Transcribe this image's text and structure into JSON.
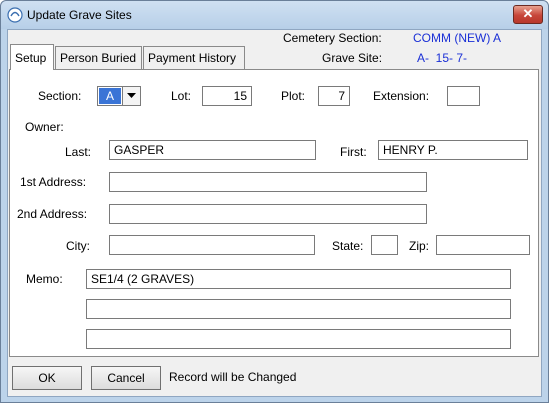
{
  "window": {
    "title": "Update Grave Sites",
    "close_glyph": "✕"
  },
  "header": {
    "cemetery_section_label": "Cemetery Section:",
    "cemetery_section_value": "COMM (NEW) A",
    "grave_site_label": "Grave Site:",
    "grave_site_value": "A-  15- 7-"
  },
  "tabs": [
    {
      "label": "Setup",
      "active": true
    },
    {
      "label": "Person Buried",
      "active": false
    },
    {
      "label": "Payment History",
      "active": false
    }
  ],
  "form": {
    "section_label": "Section:",
    "section_value": "A",
    "lot_label": "Lot:",
    "lot_value": "15",
    "plot_label": "Plot:",
    "plot_value": "7",
    "extension_label": "Extension:",
    "extension_value": "",
    "owner_label": "Owner:",
    "last_label": "Last:",
    "last_value": "GASPER",
    "first_label": "First:",
    "first_value": "HENRY P.",
    "address1_label": "1st Address:",
    "address1_value": "",
    "address2_label": "2nd Address:",
    "address2_value": "",
    "city_label": "City:",
    "city_value": "",
    "state_label": "State:",
    "state_value": "",
    "zip_label": "Zip:",
    "zip_value": "",
    "memo_label": "Memo:",
    "memo_lines": [
      "SE1/4 (2 GRAVES)",
      "",
      ""
    ]
  },
  "footer": {
    "ok_label": "OK",
    "cancel_label": "Cancel",
    "status_text": "Record will be Changed"
  },
  "colors": {
    "accent_text": "#1a2fd6",
    "selection": "#3a74d6"
  }
}
